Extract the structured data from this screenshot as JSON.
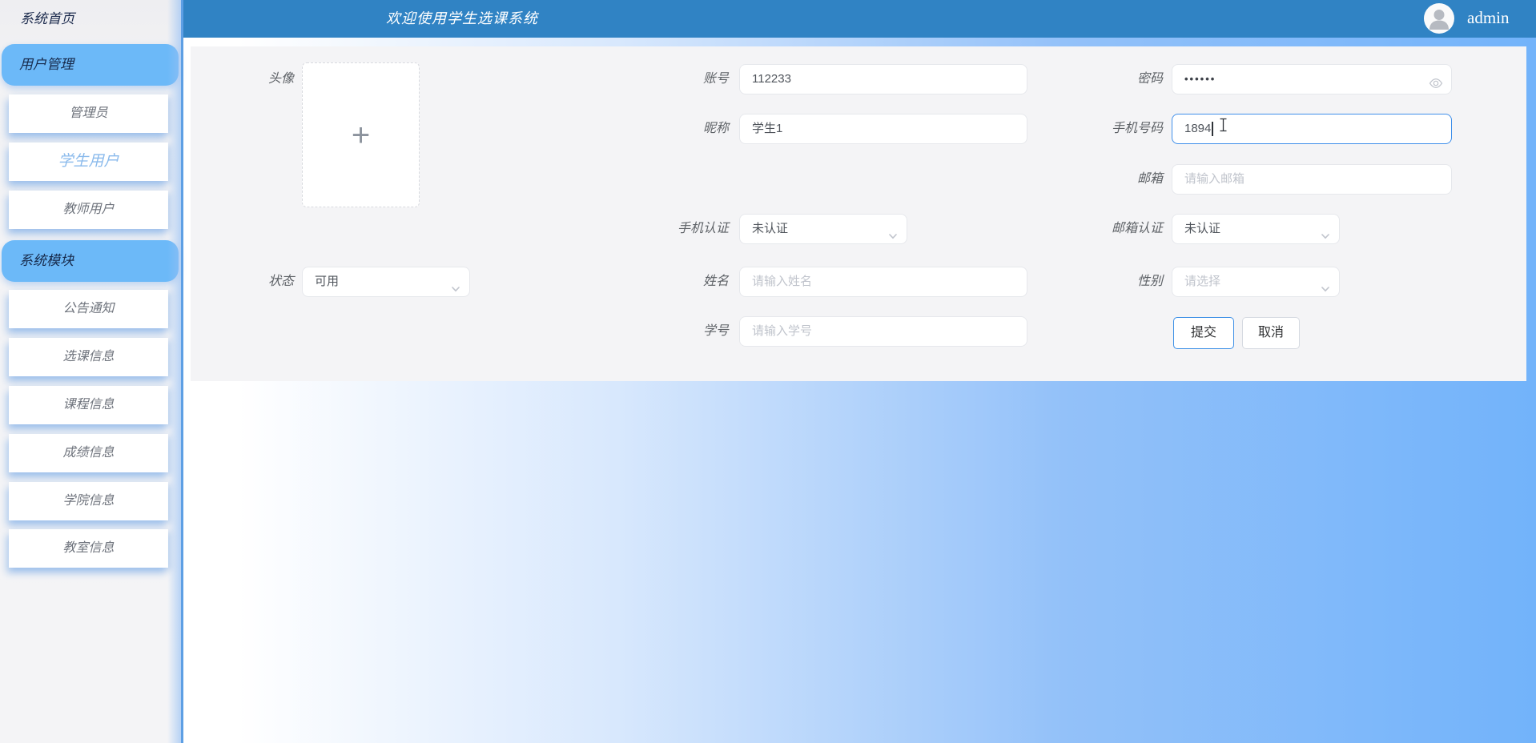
{
  "header": {
    "title": "欢迎使用学生选课系统",
    "username": "admin"
  },
  "sidebar": {
    "home": "系统首页",
    "sections": [
      {
        "label": "用户管理",
        "items": [
          {
            "label": "管理员",
            "selected": false
          },
          {
            "label": "学生用户",
            "selected": true
          },
          {
            "label": "教师用户",
            "selected": false
          }
        ]
      },
      {
        "label": "系统模块",
        "items": [
          {
            "label": "公告通知",
            "selected": false
          },
          {
            "label": "选课信息",
            "selected": false
          },
          {
            "label": "课程信息",
            "selected": false
          },
          {
            "label": "成绩信息",
            "selected": false
          },
          {
            "label": "学院信息",
            "selected": false
          },
          {
            "label": "教室信息",
            "selected": false
          }
        ]
      }
    ]
  },
  "form": {
    "avatar": {
      "label": "头像",
      "plus": "+"
    },
    "fields": {
      "account": {
        "label": "账号",
        "value": "112233"
      },
      "password": {
        "label": "密码",
        "value": "••••••"
      },
      "nickname": {
        "label": "昵称",
        "value": "学生1"
      },
      "phone": {
        "label": "手机号码",
        "value": "1894"
      },
      "email": {
        "label": "邮箱",
        "placeholder": "请输入邮箱"
      },
      "phone_verify": {
        "label": "手机认证",
        "value": "未认证"
      },
      "email_verify": {
        "label": "邮箱认证",
        "value": "未认证"
      },
      "status": {
        "label": "状态",
        "value": "可用"
      },
      "name": {
        "label": "姓名",
        "placeholder": "请输入姓名"
      },
      "gender": {
        "label": "性别",
        "placeholder": "请选择"
      },
      "student_no": {
        "label": "学号",
        "placeholder": "请输入学号"
      }
    },
    "buttons": {
      "submit": "提交",
      "cancel": "取消"
    }
  },
  "icons": {
    "eye": "eye-icon",
    "chevron": "chevron-down-icon",
    "plus": "plus-icon",
    "user": "user-avatar-icon",
    "text_cursor": "text-cursor-icon"
  },
  "colors": {
    "header_blue": "#3083c4",
    "sidebar_section_blue": "#6cb9f8",
    "divider_blue": "#5d9fe4",
    "focus_blue": "#3f8fea",
    "selected_item_text": "#8abaec",
    "content_gradient_end": "#72b3fa",
    "panel_gray": "#f4f4f6",
    "placeholder_gray": "#c0c4cc"
  }
}
